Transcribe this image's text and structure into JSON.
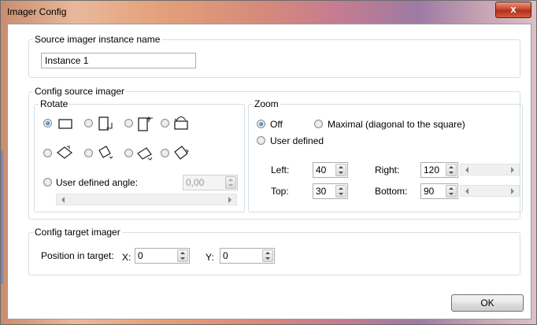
{
  "window": {
    "title": "Imager Config",
    "close_label": "x"
  },
  "source_name": {
    "legend": "Source imager instance name",
    "value": "Instance 1"
  },
  "config_source": {
    "legend": "Config source imager",
    "rotate": {
      "legend": "Rotate",
      "selected": 0,
      "user_defined_label": "User defined angle:",
      "angle_value": "0,00",
      "icons": [
        "rotate-none-icon",
        "rotate-90-cw-icon",
        "rotate-90-ccw-icon",
        "rotate-180-icon",
        "rotate-diag-1-icon",
        "rotate-diag-2-icon",
        "rotate-diag-3-icon",
        "rotate-diag-4-icon"
      ]
    },
    "zoom": {
      "legend": "Zoom",
      "off_label": "Off",
      "maximal_label": "Maximal (diagonal to the square)",
      "user_defined_label": "User defined",
      "selected": "Off",
      "left_label": "Left:",
      "left_value": "40",
      "right_label": "Right:",
      "right_value": "120",
      "top_label": "Top:",
      "top_value": "30",
      "bottom_label": "Bottom:",
      "bottom_value": "90"
    }
  },
  "config_target": {
    "legend": "Config target imager",
    "position_label": "Position in target:",
    "x_label": "X:",
    "x_value": "0",
    "y_label": "Y:",
    "y_value": "0"
  },
  "buttons": {
    "ok": "OK"
  }
}
